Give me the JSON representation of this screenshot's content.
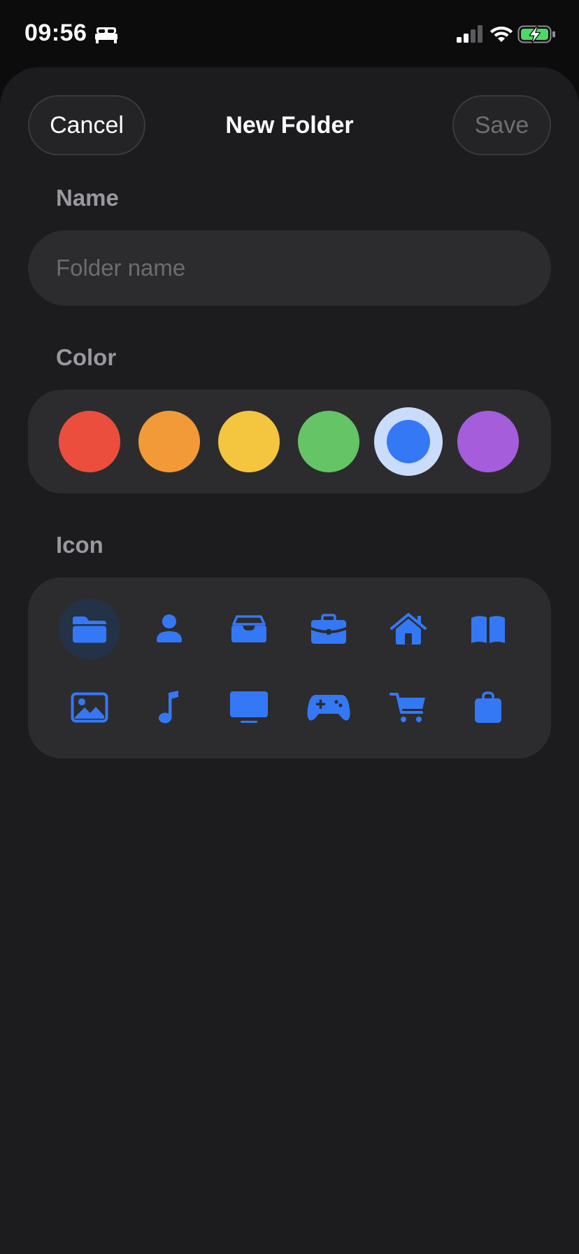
{
  "status_bar": {
    "time": "09:56",
    "icons": [
      "bed-icon",
      "cellular-signal-icon",
      "wifi-icon",
      "battery-charging-icon"
    ]
  },
  "nav": {
    "cancel_label": "Cancel",
    "title": "New Folder",
    "save_label": "Save"
  },
  "name_section": {
    "label": "Name",
    "value": "",
    "placeholder": "Folder name"
  },
  "color_section": {
    "label": "Color",
    "selected": "blue",
    "colors": [
      {
        "name": "red",
        "hex": "#eb4e3d"
      },
      {
        "name": "orange",
        "hex": "#f19a37"
      },
      {
        "name": "yellow",
        "hex": "#f4c53e"
      },
      {
        "name": "green",
        "hex": "#65c466"
      },
      {
        "name": "blue",
        "hex": "#3478f6"
      },
      {
        "name": "purple",
        "hex": "#a55ddc"
      }
    ]
  },
  "icon_section": {
    "label": "Icon",
    "selected": "folder-icon",
    "icons": [
      [
        "folder-icon",
        "person-icon",
        "tray-icon",
        "briefcase-icon",
        "house-icon",
        "book-icon"
      ],
      [
        "photo-icon",
        "music-note-icon",
        "tv-icon",
        "gamecontroller-icon",
        "cart-icon",
        "bag-icon"
      ]
    ]
  },
  "theme": {
    "accent": "#3478f6",
    "sheet_background": "#1c1c1e",
    "panel_background": "#2c2c2e"
  }
}
